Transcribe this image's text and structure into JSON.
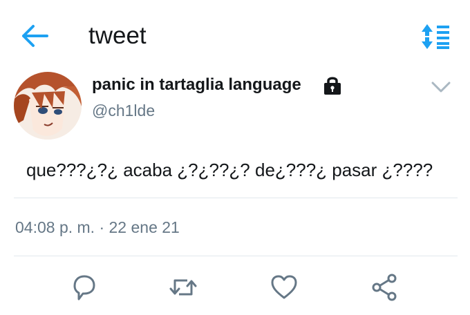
{
  "header": {
    "title": "tweet",
    "back_icon": "arrow-left-icon",
    "sort_icon": "sort-icon",
    "accent_color": "#1da1f2"
  },
  "author": {
    "display_name": "panic in tartaglia language",
    "handle": "@ch1lde",
    "protected_icon": "lock-icon",
    "menu_icon": "chevron-down-icon"
  },
  "tweet": {
    "text": "que???¿?¿ acaba ¿?¿??¿? de¿???¿ pasar ¿????",
    "timestamp": "04:08 p. m. · 22 ene 21"
  },
  "actions": {
    "reply_icon": "reply-icon",
    "retweet_icon": "retweet-icon",
    "like_icon": "heart-icon",
    "share_icon": "share-icon",
    "icon_color": "#657786"
  }
}
